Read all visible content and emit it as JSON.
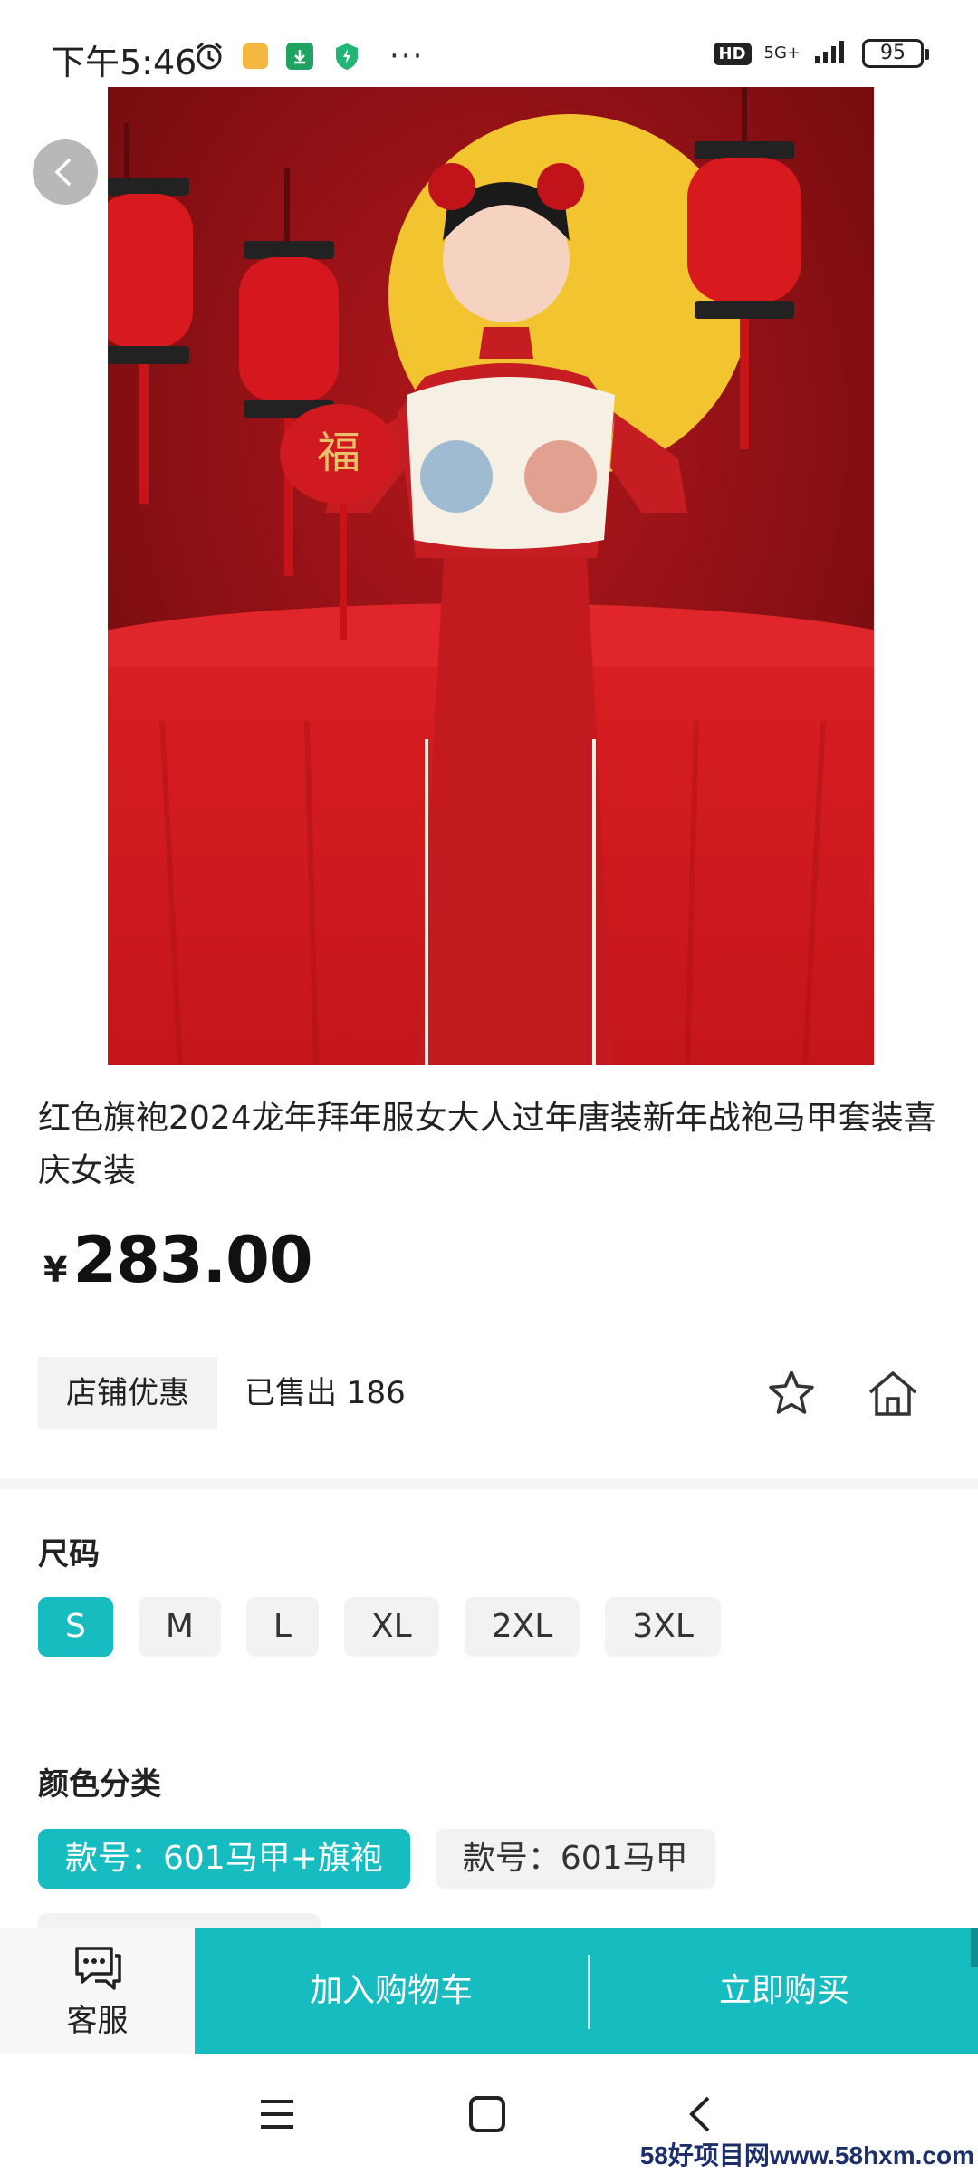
{
  "status_bar": {
    "time": "下午5:46",
    "network": "5G+",
    "hd": "HD",
    "battery": "95",
    "more": "···"
  },
  "product": {
    "title": "红色旗袍2024龙年拜年服女大人过年唐装新年战袍马甲套装喜庆女装",
    "currency": "¥",
    "price": "283.00",
    "shop_coupon": "店铺优惠",
    "sold": "已售出 186"
  },
  "size": {
    "label": "尺码",
    "options": [
      "S",
      "M",
      "L",
      "XL",
      "2XL",
      "3XL"
    ],
    "selected": "S"
  },
  "color": {
    "label": "颜色分类",
    "options": [
      "款号：601马甲+旗袍",
      "款号：601马甲"
    ],
    "selected": "款号：601马甲+旗袍"
  },
  "action_bar": {
    "service": "客服",
    "add_to_cart": "加入购物车",
    "buy_now": "立即购买"
  },
  "watermark": "58好项目网www.58hxm.com",
  "colors": {
    "accent": "#17bcc0",
    "hero_red": "#c8161d"
  }
}
